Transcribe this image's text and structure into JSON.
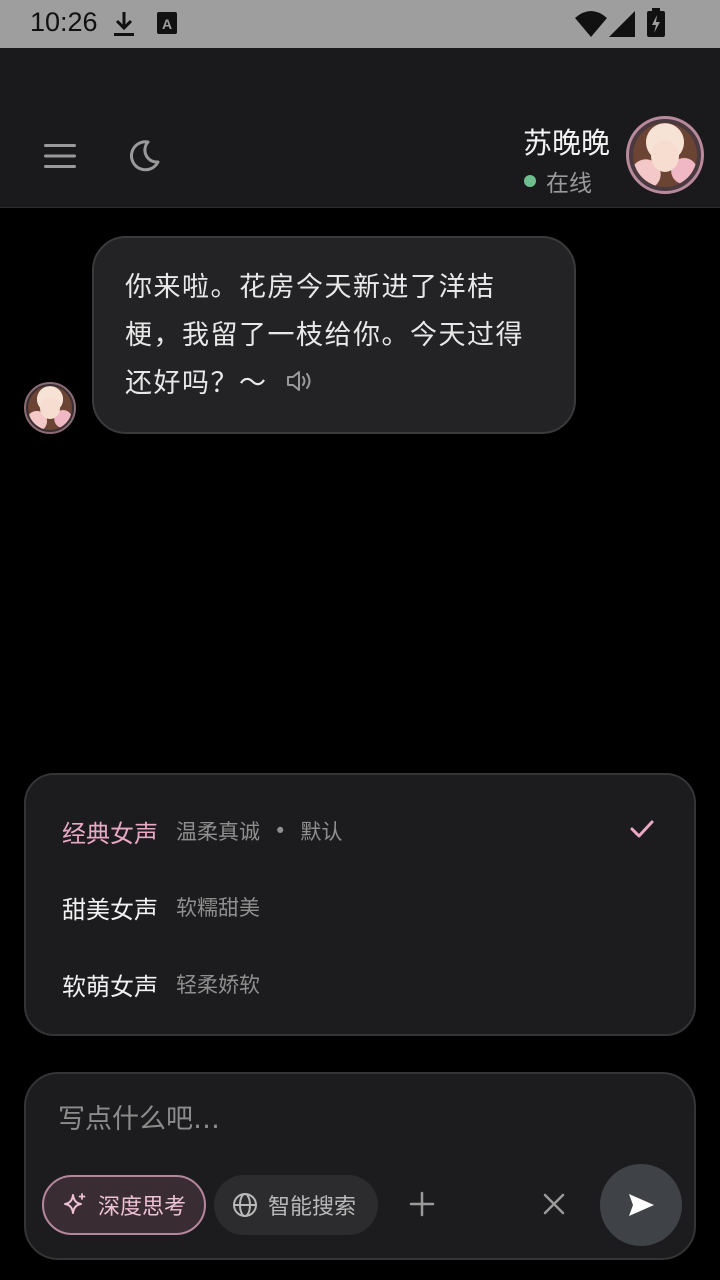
{
  "status_bar": {
    "time": "10:26"
  },
  "header": {
    "contact_name": "苏晚晚",
    "status": "在线"
  },
  "messages": [
    {
      "from": "contact",
      "text": "你来啦。花房今天新进了洋桔梗，我留了一枝给你。今天过得还好吗？～"
    }
  ],
  "voice_options": [
    {
      "name": "经典女声",
      "desc": "温柔真诚",
      "tag": "默认",
      "selected": true
    },
    {
      "name": "甜美女声",
      "desc": "软糯甜美",
      "selected": false
    },
    {
      "name": "软萌女声",
      "desc": "轻柔娇软",
      "selected": false
    }
  ],
  "composer": {
    "placeholder": "写点什么吧…",
    "deep_think_label": "深度思考",
    "smart_search_label": "智能搜索"
  },
  "colors": {
    "accent_pink": "#e9a8c4",
    "online": "#6fbf8e"
  }
}
